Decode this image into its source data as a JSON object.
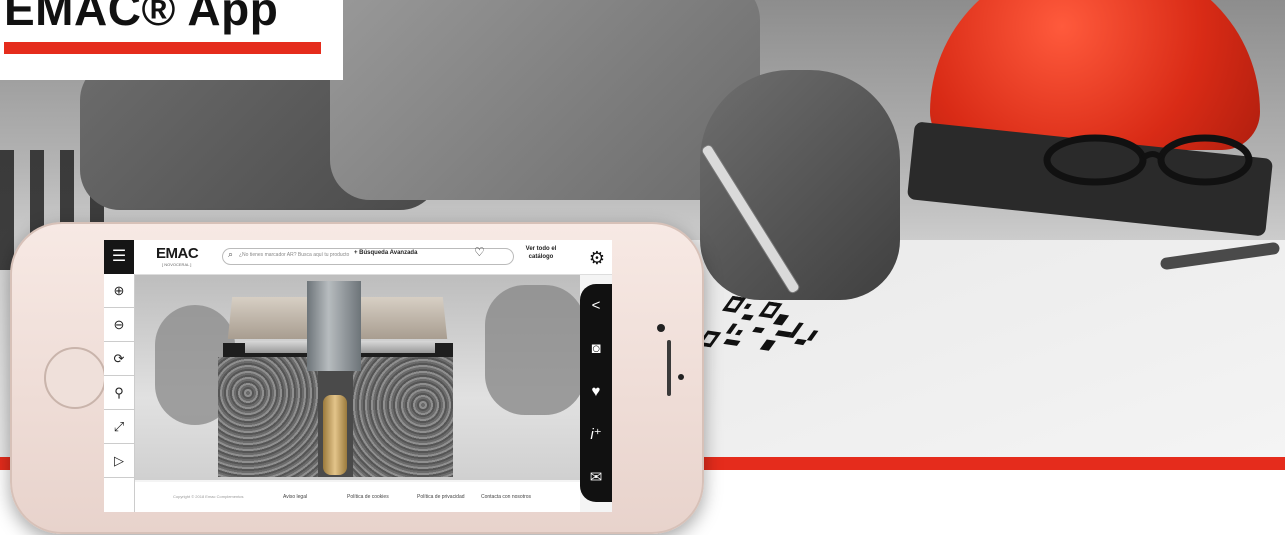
{
  "page": {
    "title": "EMAC® App",
    "accent_color": "#e52c1c"
  },
  "app": {
    "logo": {
      "main": "EMAC",
      "sub": "[ NOVOCERAL ]"
    },
    "menu_icon": "hamburger-icon",
    "search": {
      "placeholder": "¿No tienes marcador AR? Busca aquí tu producto",
      "icon": "search-icon"
    },
    "advanced_search_label": "+ Búsqueda Avanzada",
    "favorites_icon": "heart-outline-icon",
    "catalog_label": "Ver todo el catálogo",
    "settings_icon": "gear-icon",
    "tools": [
      {
        "name": "zoom-in-icon",
        "glyph": "⊕"
      },
      {
        "name": "zoom-out-icon",
        "glyph": "⊖"
      },
      {
        "name": "rotate-icon",
        "glyph": "⟳"
      },
      {
        "name": "magnifier-icon",
        "glyph": "🔍"
      },
      {
        "name": "fullscreen-icon",
        "glyph": "⛶"
      },
      {
        "name": "play-icon",
        "glyph": "▷"
      }
    ],
    "actions": [
      {
        "name": "share-icon",
        "glyph": "<"
      },
      {
        "name": "camera-icon",
        "glyph": "📷"
      },
      {
        "name": "heart-icon",
        "glyph": "♥"
      },
      {
        "name": "info-icon",
        "glyph": "i⁺"
      },
      {
        "name": "mail-icon",
        "glyph": "✉"
      }
    ],
    "footer": {
      "copyright": "Copyright © 2018 Emac Complementos",
      "links": [
        "Aviso legal",
        "Política de cookies",
        "Política de privacidad",
        "Contacta con nosotros"
      ]
    }
  }
}
